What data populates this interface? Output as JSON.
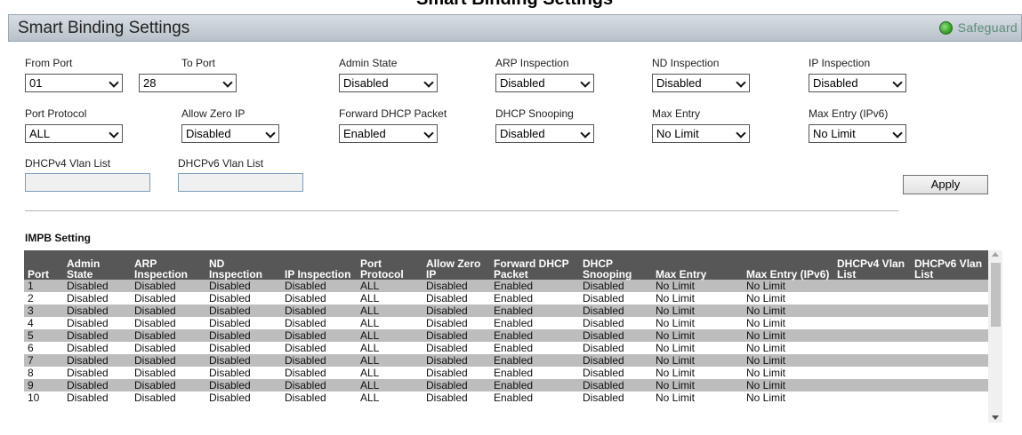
{
  "page_title_partial": "Smart Binding Settings",
  "header": {
    "title": "Smart Binding Settings",
    "safeguard_label": "Safeguard"
  },
  "form": {
    "from_port": {
      "label": "From Port",
      "value": "01"
    },
    "to_port": {
      "label": "To Port",
      "value": "28"
    },
    "admin_state": {
      "label": "Admin State",
      "value": "Disabled"
    },
    "arp_inspection": {
      "label": "ARP Inspection",
      "value": "Disabled"
    },
    "nd_inspection": {
      "label": "ND Inspection",
      "value": "Disabled"
    },
    "ip_inspection": {
      "label": "IP Inspection",
      "value": "Disabled"
    },
    "port_protocol": {
      "label": "Port Protocol",
      "value": "ALL"
    },
    "allow_zero_ip": {
      "label": "Allow Zero IP",
      "value": "Disabled"
    },
    "forward_dhcp_packet": {
      "label": "Forward DHCP Packet",
      "value": "Enabled"
    },
    "dhcp_snooping": {
      "label": "DHCP Snooping",
      "value": "Disabled"
    },
    "max_entry": {
      "label": "Max Entry",
      "value": "No Limit"
    },
    "max_entry_ipv6": {
      "label": "Max Entry (IPv6)",
      "value": "No Limit"
    },
    "dhcpv4_vlan_list": {
      "label": "DHCPv4 Vlan List",
      "value": ""
    },
    "dhcpv6_vlan_list": {
      "label": "DHCPv6 Vlan List",
      "value": ""
    },
    "apply_label": "Apply"
  },
  "impb": {
    "title": "IMPB Setting",
    "columns": [
      "Port",
      "Admin State",
      "ARP Inspection",
      "ND Inspection",
      "IP Inspection",
      "Port Protocol",
      "Allow Zero IP",
      "Forward DHCP Packet",
      "DHCP Snooping",
      "Max Entry",
      "Max Entry (IPv6)",
      "DHCPv4 Vlan List",
      "DHCPv6 Vlan List"
    ],
    "rows": [
      [
        "1",
        "Disabled",
        "Disabled",
        "Disabled",
        "Disabled",
        "ALL",
        "Disabled",
        "Enabled",
        "Disabled",
        "No Limit",
        "No Limit",
        "",
        ""
      ],
      [
        "2",
        "Disabled",
        "Disabled",
        "Disabled",
        "Disabled",
        "ALL",
        "Disabled",
        "Enabled",
        "Disabled",
        "No Limit",
        "No Limit",
        "",
        ""
      ],
      [
        "3",
        "Disabled",
        "Disabled",
        "Disabled",
        "Disabled",
        "ALL",
        "Disabled",
        "Enabled",
        "Disabled",
        "No Limit",
        "No Limit",
        "",
        ""
      ],
      [
        "4",
        "Disabled",
        "Disabled",
        "Disabled",
        "Disabled",
        "ALL",
        "Disabled",
        "Enabled",
        "Disabled",
        "No Limit",
        "No Limit",
        "",
        ""
      ],
      [
        "5",
        "Disabled",
        "Disabled",
        "Disabled",
        "Disabled",
        "ALL",
        "Disabled",
        "Enabled",
        "Disabled",
        "No Limit",
        "No Limit",
        "",
        ""
      ],
      [
        "6",
        "Disabled",
        "Disabled",
        "Disabled",
        "Disabled",
        "ALL",
        "Disabled",
        "Enabled",
        "Disabled",
        "No Limit",
        "No Limit",
        "",
        ""
      ],
      [
        "7",
        "Disabled",
        "Disabled",
        "Disabled",
        "Disabled",
        "ALL",
        "Disabled",
        "Enabled",
        "Disabled",
        "No Limit",
        "No Limit",
        "",
        ""
      ],
      [
        "8",
        "Disabled",
        "Disabled",
        "Disabled",
        "Disabled",
        "ALL",
        "Disabled",
        "Enabled",
        "Disabled",
        "No Limit",
        "No Limit",
        "",
        ""
      ],
      [
        "9",
        "Disabled",
        "Disabled",
        "Disabled",
        "Disabled",
        "ALL",
        "Disabled",
        "Enabled",
        "Disabled",
        "No Limit",
        "No Limit",
        "",
        ""
      ],
      [
        "10",
        "Disabled",
        "Disabled",
        "Disabled",
        "Disabled",
        "ALL",
        "Disabled",
        "Enabled",
        "Disabled",
        "No Limit",
        "No Limit",
        "",
        ""
      ]
    ]
  },
  "colors": {
    "header_bg": "#c5ccd3",
    "table_header_bg": "#575757",
    "row_alt_bg": "#bdbdbd",
    "safeguard_dot": "#3aa22a"
  }
}
